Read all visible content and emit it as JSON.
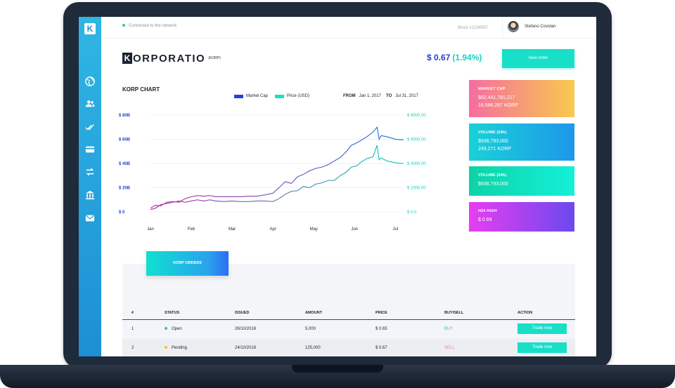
{
  "header": {
    "status_text": "Connected to the network",
    "block_text": "Block #1234567",
    "user_name": "Stefano Covolan"
  },
  "brand": {
    "logo_letter": "K",
    "name": "ORPORATIO",
    "symbol": "(KORP)"
  },
  "price": {
    "value": "$ 0.67",
    "change": "(1.94%)"
  },
  "new_order_label": "New order",
  "sidebar": {
    "items": [
      {
        "icon": "globe-icon"
      },
      {
        "icon": "users-icon"
      },
      {
        "icon": "double-check-icon"
      },
      {
        "icon": "credit-card-icon"
      },
      {
        "icon": "transfer-arrows-icon"
      },
      {
        "icon": "bank-icon"
      },
      {
        "icon": "mail-icon"
      }
    ]
  },
  "chart": {
    "title": "KORP CHART",
    "legend": [
      {
        "label": "Market Cap",
        "color": "#2540d9"
      },
      {
        "label": "Price (USD)",
        "color": "#17dfc8"
      }
    ],
    "range": {
      "from_label": "FROM",
      "from": "Jan 1, 2017",
      "to_label": "TO",
      "to": "Jul 31, 2017"
    }
  },
  "chart_data": {
    "type": "line",
    "title": "KORP CHART",
    "x_labels": [
      "Jan",
      "Feb",
      "Mar",
      "Apr",
      "May",
      "Jun",
      "Jul"
    ],
    "y_left_ticks": [
      "$ 80B",
      "$ 60B",
      "$ 40B",
      "$ 20B",
      "$ 0"
    ],
    "y_left_range": [
      0,
      80
    ],
    "y_right_ticks": [
      "$ 8000.00",
      "$ 6000.00",
      "$ 4000.00",
      "$ 2000.00",
      "$ 0.0"
    ],
    "y_right_range": [
      0,
      8000
    ],
    "grid": true,
    "series": [
      {
        "name": "Market Cap",
        "axis": "left",
        "color_start": "#c2379b",
        "color_end": "#2f7fe0",
        "x": [
          0,
          0.12,
          0.25,
          0.4,
          0.55,
          0.7,
          0.85,
          1,
          1.15,
          1.3,
          1.45,
          1.6,
          1.8,
          2.0,
          2.2,
          2.4,
          2.6,
          2.8,
          3.0,
          3.15,
          3.3,
          3.45,
          3.6,
          3.75,
          3.9,
          4.05,
          4.2,
          4.35,
          4.5,
          4.65,
          4.8,
          4.92,
          5.05,
          5.15,
          5.3,
          5.45,
          5.55,
          5.6,
          5.65,
          5.8,
          6.0,
          6.2
        ],
        "values": [
          3,
          5.5,
          5,
          8,
          8.5,
          8,
          11,
          12.5,
          13.5,
          13,
          13.5,
          12.5,
          12.5,
          12.5,
          12.5,
          13,
          13,
          14,
          15.5,
          20,
          25,
          23.5,
          29,
          31,
          34,
          36,
          37,
          39,
          42,
          45,
          50,
          55,
          57,
          59,
          62,
          66,
          70,
          60,
          63,
          62,
          60,
          59.5
        ]
      },
      {
        "name": "Price (USD)",
        "axis": "right",
        "color_start": "#b62da8",
        "color_end": "#17d3be",
        "x": [
          0,
          0.12,
          0.25,
          0.4,
          0.55,
          0.7,
          0.85,
          1,
          1.15,
          1.3,
          1.45,
          1.6,
          1.8,
          2.0,
          2.2,
          2.4,
          2.6,
          2.8,
          3.0,
          3.15,
          3.3,
          3.45,
          3.6,
          3.75,
          3.9,
          4.05,
          4.2,
          4.35,
          4.5,
          4.65,
          4.8,
          4.92,
          5.05,
          5.15,
          5.3,
          5.45,
          5.55,
          5.6,
          5.65,
          5.8,
          6.0,
          6.2
        ],
        "values": [
          200,
          300,
          600,
          700,
          800,
          900,
          800,
          900,
          1000,
          900,
          1000,
          900,
          850,
          900,
          850,
          850,
          900,
          900,
          850,
          1100,
          1450,
          1700,
          1750,
          2100,
          2000,
          2300,
          2400,
          2600,
          2600,
          3000,
          3300,
          3700,
          3800,
          4100,
          4400,
          4550,
          5500,
          4300,
          4450,
          4200,
          4050,
          4000
        ]
      }
    ]
  },
  "stats": [
    {
      "title": "MARKET CAP",
      "value1": "$62,441,781,217",
      "value2": "16,586,287 KORP",
      "gradient": [
        "#f56da0",
        "#f9c94e"
      ]
    },
    {
      "title": "VOLUME (24h)",
      "value1": "$938,793,000",
      "value2": "249,271 KORP",
      "gradient": [
        "#19d2d6",
        "#1e97ea"
      ]
    },
    {
      "title": "VOLUME (24h)",
      "value1": "$938,793,000",
      "value2": "",
      "gradient": [
        "#0dd3a6",
        "#14f0d8"
      ]
    },
    {
      "title": "H24 HIGH",
      "value1": "$ 0.69",
      "value2": "",
      "gradient": [
        "#e63ef0",
        "#6c49ee"
      ]
    }
  ],
  "orders": {
    "tab_label": "KORP ORDERS",
    "columns": [
      "#",
      "STATUS",
      "ISSUED",
      "AMOUNT",
      "PRICE",
      "BUY/SELL",
      "ACTION"
    ],
    "rows": [
      {
        "num": "1",
        "status": "Open",
        "status_color": "#2ecc8f",
        "issued": "26/10/2018",
        "amount": "5,000",
        "price": "$ 0.65",
        "side": "BUY",
        "side_color": "#17d3be",
        "action": "Trade now"
      },
      {
        "num": "2",
        "status": "Pending",
        "status_color": "#f5c518",
        "issued": "24/10/2018",
        "amount": "125,000",
        "price": "$ 0.67",
        "side": "SELL",
        "side_color": "#f178b6",
        "action": "Trade now"
      }
    ]
  }
}
